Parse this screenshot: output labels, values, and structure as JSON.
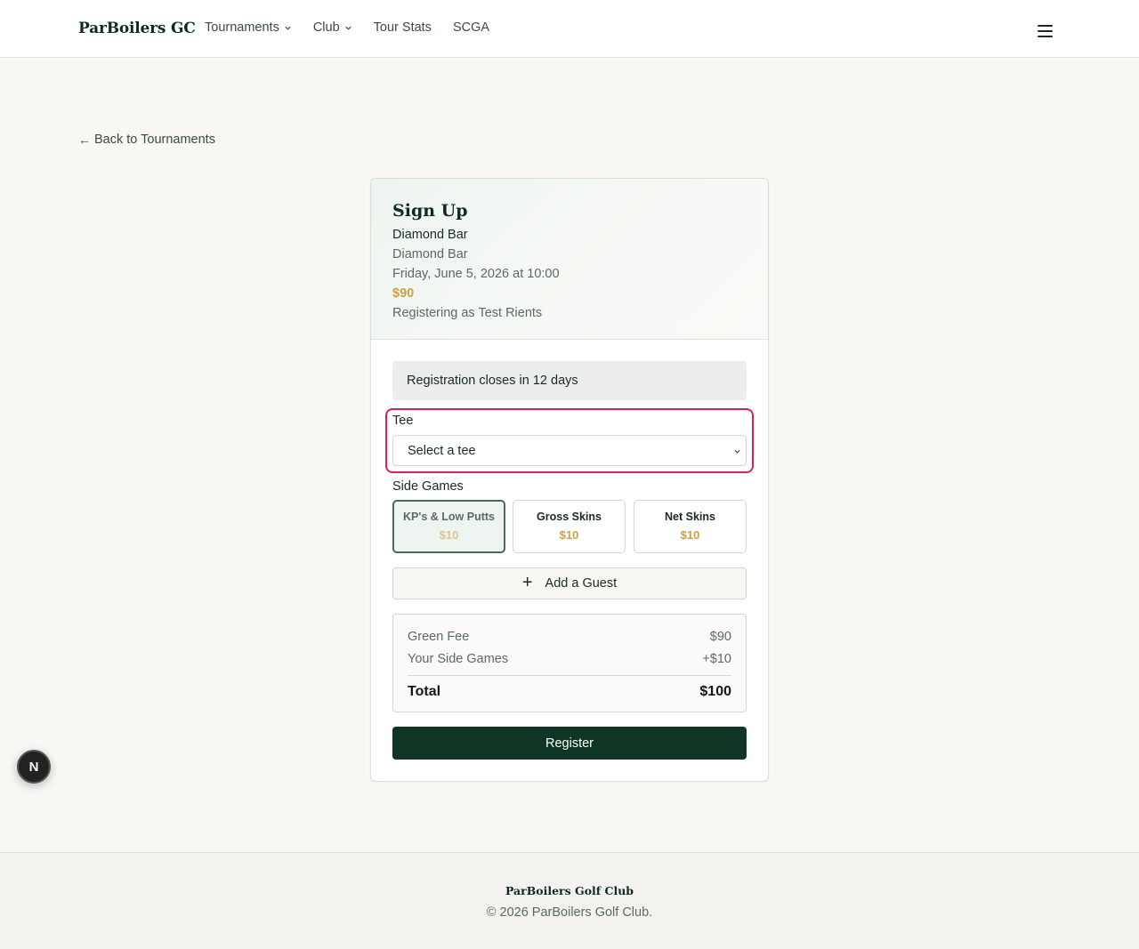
{
  "header": {
    "brand": "ParBoilers GC",
    "nav": [
      {
        "label": "Tournaments",
        "dropdown": true
      },
      {
        "label": "Club",
        "dropdown": true
      },
      {
        "label": "Tour Stats",
        "dropdown": false
      },
      {
        "label": "SCGA",
        "dropdown": false
      }
    ],
    "menu_icon": "hamburger-icon"
  },
  "back_link": {
    "icon": "arrow-left-icon",
    "label": "Back to Tournaments"
  },
  "signup": {
    "title": "Sign Up",
    "event_name": "Diamond Bar",
    "course": "Diamond Bar",
    "datetime": "Friday, June 5, 2026 at 10:00",
    "price": "$90",
    "registering_as": "Registering as Test Rients",
    "notice": "Registration closes in 12 days",
    "tee": {
      "label": "Tee",
      "selected": "Select a tee"
    },
    "side_games": {
      "label": "Side Games",
      "items": [
        {
          "name": "KP's & Low Putts",
          "price": "$10",
          "selected": true
        },
        {
          "name": "Gross Skins",
          "price": "$10",
          "selected": false
        },
        {
          "name": "Net Skins",
          "price": "$10",
          "selected": false
        }
      ]
    },
    "add_guest": {
      "icon": "plus-icon",
      "label": "Add a Guest"
    },
    "summary": {
      "green_fee_label": "Green Fee",
      "green_fee_value": "$90",
      "side_games_label": "Your Side Games",
      "side_games_value": "+$10",
      "total_label": "Total",
      "total_value": "$100"
    },
    "register_label": "Register"
  },
  "badge": {
    "letter": "N"
  },
  "footer": {
    "title": "ParBoilers Golf Club",
    "copyright": "© 2026 ParBoilers Golf Club."
  },
  "colors": {
    "brand_green": "#0f3624",
    "accent_gold": "#c9a24a",
    "highlight": "#d4245a",
    "background": "#f8f7f4"
  }
}
